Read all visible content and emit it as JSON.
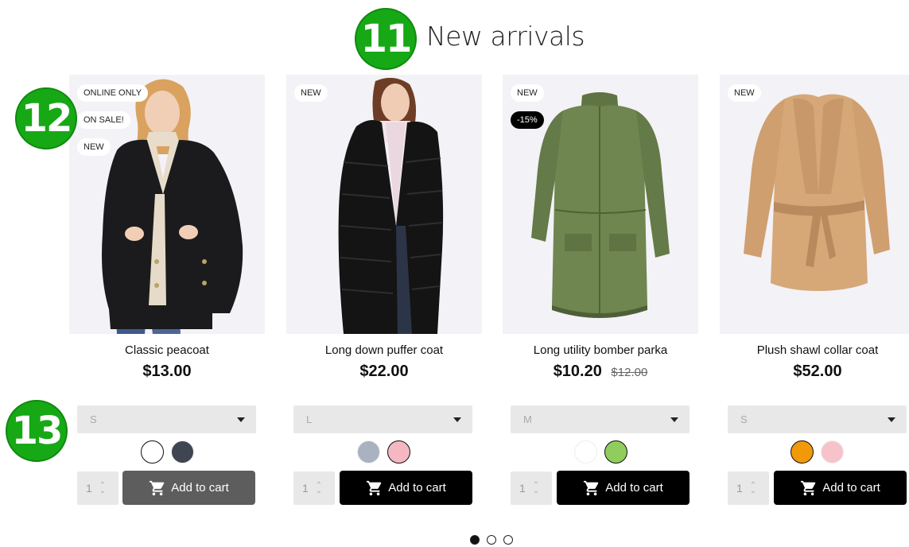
{
  "markers": {
    "m11": "11",
    "m12": "12",
    "m13": "13"
  },
  "section_title": "New arrivals",
  "products": [
    {
      "name": "Classic peacoat",
      "price": "$13.00",
      "old_price": "",
      "badges": [
        "ONLINE ONLY",
        "ON SALE!",
        "NEW"
      ],
      "size": "S",
      "swatches": [
        "#ffffff",
        "#3f4651"
      ],
      "qty": "1",
      "cart_label": "Add to cart",
      "cart_disabled": true
    },
    {
      "name": "Long down puffer coat",
      "price": "$22.00",
      "old_price": "",
      "badges": [
        "NEW"
      ],
      "size": "L",
      "swatches": [
        "#a9b2c0",
        "#f5b8c2"
      ],
      "qty": "1",
      "cart_label": "Add to cart",
      "cart_disabled": false
    },
    {
      "name": "Long utility bomber parka",
      "price": "$10.20",
      "old_price": "$12.00",
      "badges": [
        "NEW",
        "-15%"
      ],
      "size": "M",
      "swatches": [
        "#ffffff",
        "#8fce5c"
      ],
      "qty": "1",
      "cart_label": "Add to cart",
      "cart_disabled": false
    },
    {
      "name": "Plush shawl collar coat",
      "price": "$52.00",
      "old_price": "",
      "badges": [
        "NEW"
      ],
      "size": "S",
      "swatches": [
        "#f2990a",
        "#f7c3ca"
      ],
      "qty": "1",
      "cart_label": "Add to cart",
      "cart_disabled": false
    }
  ],
  "pagination": {
    "count": 3,
    "active": 0
  },
  "colors": {
    "accent_green": "#17a816",
    "button": "#000000",
    "button_disabled": "#5d5d5d"
  }
}
